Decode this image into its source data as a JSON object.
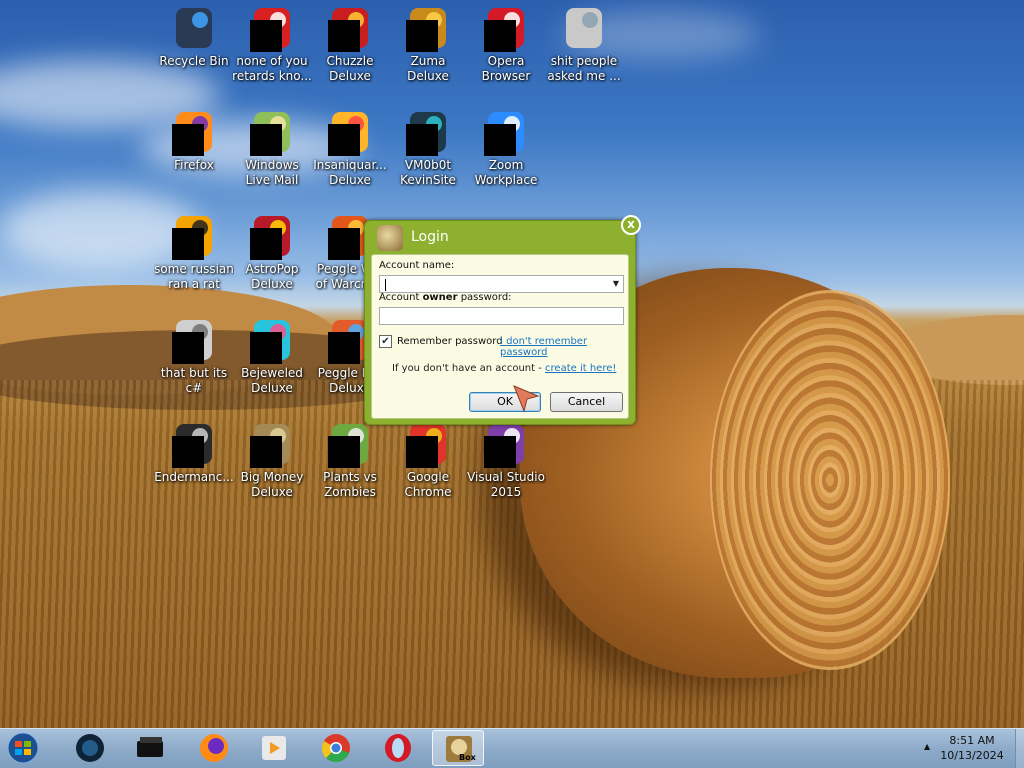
{
  "desktop": {
    "icons": [
      {
        "label": "Recycle Bin",
        "icon": "recycle-bin-icon",
        "color": "#2a3a55",
        "accent": "#3fa4ff",
        "masked": false
      },
      {
        "label": "none of you retards kno...",
        "icon": "red-swirl-icon",
        "color": "#d92020",
        "accent": "#ffffff",
        "masked": true
      },
      {
        "label": "Chuzzle Deluxe",
        "icon": "chuzzle-icon",
        "color": "#c81e1e",
        "accent": "#ffcc33",
        "masked": true
      },
      {
        "label": "Zuma Deluxe",
        "icon": "zuma-icon",
        "color": "#c98a1c",
        "accent": "#ffd24a",
        "masked": true
      },
      {
        "label": "Opera Browser",
        "icon": "opera-icon",
        "color": "#d41a26",
        "accent": "#ffffff",
        "masked": true
      },
      {
        "label": "shit people asked me ...",
        "icon": "folder-icon",
        "color": "#c9c9c9",
        "accent": "#8aa0b0",
        "masked": false
      },
      {
        "label": "Firefox",
        "icon": "firefox-icon",
        "color": "#ff8c1a",
        "accent": "#6d2bbd",
        "masked": true
      },
      {
        "label": "Windows Live Mail",
        "icon": "mail-icon",
        "color": "#8fbe5a",
        "accent": "#f4e6a6",
        "masked": true
      },
      {
        "label": "Insaniquar... Deluxe",
        "icon": "insaniquarium-icon",
        "color": "#ffb52a",
        "accent": "#ff4444",
        "masked": true
      },
      {
        "label": "VM0b0t KevinSite",
        "icon": "vm-icon",
        "color": "#1e3a4a",
        "accent": "#2ec5d2",
        "masked": true
      },
      {
        "label": "Zoom Workplace",
        "icon": "zoom-icon",
        "color": "#2d8cff",
        "accent": "#ffffff",
        "masked": true
      },
      {
        "label": "some russian ran a rat",
        "icon": "e-app-icon",
        "color": "#f5a300",
        "accent": "#222222",
        "masked": true
      },
      {
        "label": "AstroPop Deluxe",
        "icon": "astropop-icon",
        "color": "#b81a2a",
        "accent": "#ffd800",
        "masked": true
      },
      {
        "label": "Peggle W... of Warcra...",
        "icon": "peggle-wow-icon",
        "color": "#e4571b",
        "accent": "#ffcb3b",
        "masked": true
      },
      {
        "label": "that but its c#",
        "icon": "shortcut-stack-icon",
        "color": "#cfcfcf",
        "accent": "#707070",
        "masked": true
      },
      {
        "label": "Bejeweled Deluxe",
        "icon": "bejeweled-icon",
        "color": "#27c4dc",
        "accent": "#ff4c8a",
        "masked": true
      },
      {
        "label": "Peggle N... Deluxe",
        "icon": "peggle-nights-icon",
        "color": "#e35b2b",
        "accent": "#48b0ff",
        "masked": true
      },
      {
        "label": "Endermanc...",
        "icon": "enderman-icon",
        "color": "#2b2b2b",
        "accent": "#cfcfcf",
        "masked": true
      },
      {
        "label": "Big Money Deluxe",
        "icon": "big-money-icon",
        "color": "#a48a56",
        "accent": "#e4d29a",
        "masked": true
      },
      {
        "label": "Plants vs Zombies",
        "icon": "pvz-icon",
        "color": "#6ea840",
        "accent": "#f0f0f0",
        "masked": true
      },
      {
        "label": "Google Chrome",
        "icon": "chrome-icon",
        "color": "#e0332a",
        "accent": "#f2c41a",
        "masked": true
      },
      {
        "label": "Visual Studio 2015",
        "icon": "visual-studio-icon",
        "color": "#7e3fa8",
        "accent": "#ffffff",
        "masked": true
      }
    ]
  },
  "dialog": {
    "title": "Login",
    "account_label": "Account name:",
    "account_value": "",
    "password_label_pre": "Account ",
    "password_label_bold": "owner",
    "password_label_post": " password:",
    "password_value": "",
    "remember_checked": true,
    "remember_label": "Remember password",
    "forgot_link": "I don't remember password",
    "no_account_text": "If you don't have an account - ",
    "create_link": "create it here!",
    "ok_label": "OK",
    "cancel_label": "Cancel",
    "close_glyph": "x",
    "accent": "#8db02f"
  },
  "taskbar": {
    "items": [
      {
        "name": "start-button",
        "icon": "windows-orb-icon"
      },
      {
        "name": "taskbar-item-orb-app",
        "icon": "dark-orb-icon"
      },
      {
        "name": "taskbar-item-black-box",
        "icon": "black-box-icon"
      },
      {
        "name": "taskbar-item-firefox",
        "icon": "firefox-icon"
      },
      {
        "name": "taskbar-item-media",
        "icon": "media-player-icon"
      },
      {
        "name": "taskbar-item-chrome",
        "icon": "chrome-icon"
      },
      {
        "name": "taskbar-item-opera",
        "icon": "opera-icon"
      },
      {
        "name": "taskbar-item-sandbox",
        "icon": "sandbox-icon",
        "label": "Box"
      }
    ],
    "tray_arrow": "▲",
    "clock_time": "8:51 AM",
    "clock_date": "10/13/2024"
  }
}
